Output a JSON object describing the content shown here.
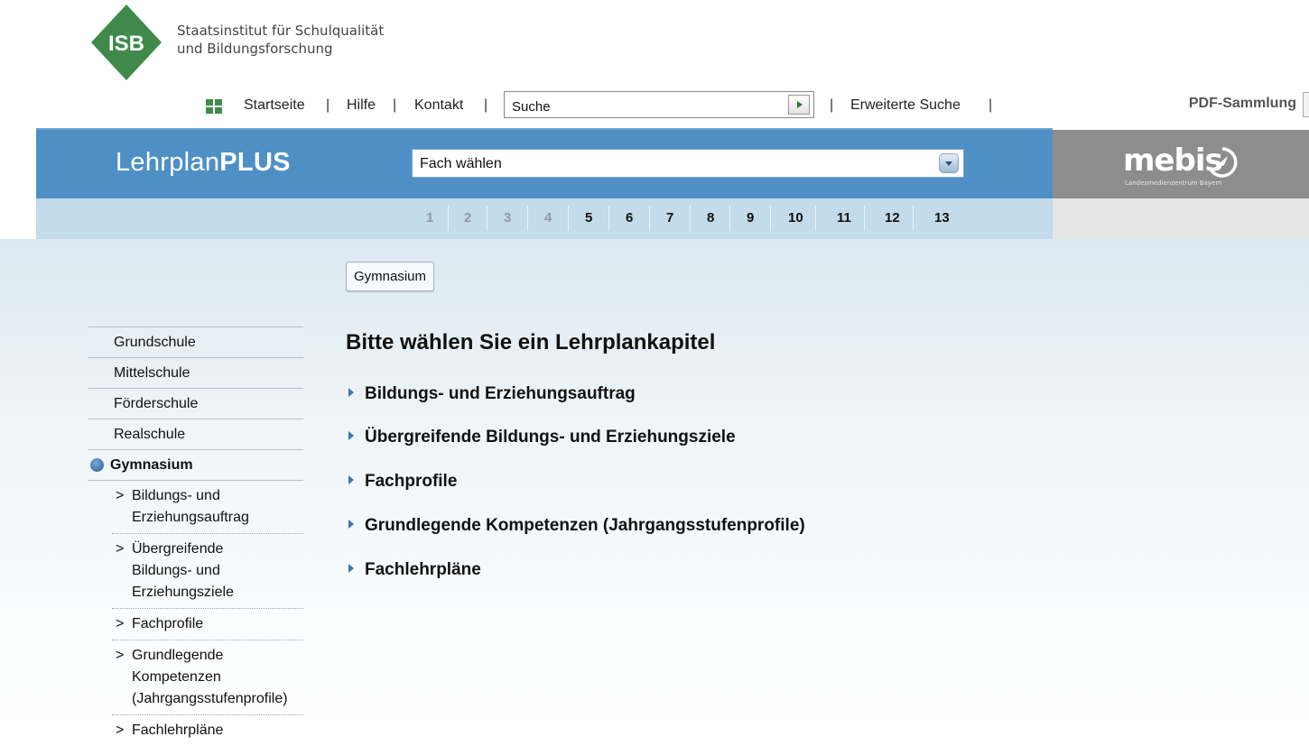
{
  "header": {
    "logo_mark": "ISB",
    "org_line1": "Staatsinstitut für Schulqualität",
    "org_line2": "und Bildungsforschung"
  },
  "topnav": {
    "home": "Startseite",
    "help": "Hilfe",
    "contact": "Kontakt",
    "search_value": "Suche",
    "advanced_search": "Erweiterte Suche",
    "separator": "|",
    "pdf": "PDF-Sammlung"
  },
  "band": {
    "brand_light": "Lehrplan",
    "brand_bold": "PLUS",
    "subject_select": "Fach wählen",
    "partner_name": "mebis",
    "partner_sub": "Landesmedienzentrum Bayern"
  },
  "grades": [
    {
      "label": "1",
      "active": false
    },
    {
      "label": "2",
      "active": false
    },
    {
      "label": "3",
      "active": false
    },
    {
      "label": "4",
      "active": false
    },
    {
      "label": "5",
      "active": true
    },
    {
      "label": "6",
      "active": true
    },
    {
      "label": "7",
      "active": true
    },
    {
      "label": "8",
      "active": true
    },
    {
      "label": "9",
      "active": true
    },
    {
      "label": "10",
      "active": true
    },
    {
      "label": "11",
      "active": true
    },
    {
      "label": "12",
      "active": true
    },
    {
      "label": "13",
      "active": true
    }
  ],
  "school_tab": "Gymnasium",
  "sidebar": {
    "schools": [
      "Grundschule",
      "Mittelschule",
      "Förderschule",
      "Realschule"
    ],
    "current": "Gymnasium",
    "subitems": [
      [
        "Bildungs- und",
        "Erziehungsauftrag"
      ],
      [
        "Übergreifende",
        "Bildungs- und",
        "Erziehungsziele"
      ],
      [
        "Fachprofile"
      ],
      [
        "Grundlegende",
        "Kompetenzen",
        "(Jahrgangsstufenprofile)"
      ],
      [
        "Fachlehrpläne"
      ]
    ],
    "chevron": ">"
  },
  "main": {
    "heading": "Bitte wählen Sie ein Lehrplankapitel",
    "chapters": [
      "Bildungs- und Erziehungsauftrag",
      "Übergreifende Bildungs- und Erziehungsziele",
      "Fachprofile",
      "Grundlegende Kompetenzen (Jahrgangsstufenprofile)",
      "Fachlehrpläne"
    ]
  },
  "colors": {
    "band_blue": "#4e90c5",
    "grade_strip": "#c3dbeb",
    "partner_gray": "#8d8d8d",
    "logo_green": "#3f8a4a"
  }
}
